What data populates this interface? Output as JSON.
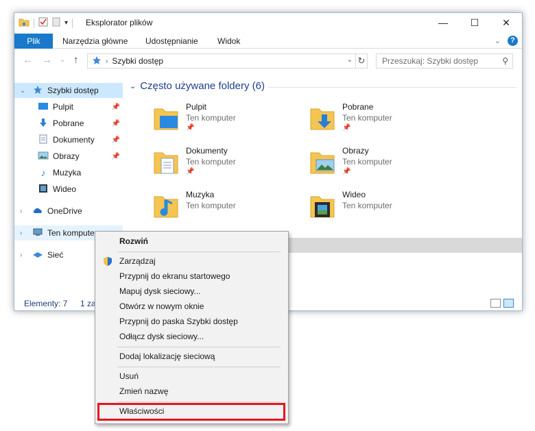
{
  "window": {
    "title": "Eksplorator plików",
    "controls": {
      "minimize": "—",
      "maximize": "☐",
      "close": "✕"
    }
  },
  "ribbon": {
    "tabs": [
      "Plik",
      "Narzędzia główne",
      "Udostępnianie",
      "Widok"
    ],
    "help": "?"
  },
  "address": {
    "breadcrumb": "Szybki dostęp",
    "search_placeholder": "Przeszukaj: Szybki dostęp"
  },
  "sidebar": {
    "items": [
      {
        "label": "Szybki dostęp",
        "icon": "star-icon"
      },
      {
        "label": "Pulpit",
        "icon": "desktop-icon",
        "pinned": true
      },
      {
        "label": "Pobrane",
        "icon": "download-icon",
        "pinned": true
      },
      {
        "label": "Dokumenty",
        "icon": "document-icon",
        "pinned": true
      },
      {
        "label": "Obrazy",
        "icon": "pictures-icon",
        "pinned": true
      },
      {
        "label": "Muzyka",
        "icon": "music-icon"
      },
      {
        "label": "Wideo",
        "icon": "video-icon"
      },
      {
        "label": "OneDrive",
        "icon": "cloud-icon"
      },
      {
        "label": "Ten komputer",
        "icon": "computer-icon"
      },
      {
        "label": "Sieć",
        "icon": "network-icon"
      }
    ]
  },
  "content": {
    "group_title": "Często używane foldery (6)",
    "folders": [
      {
        "name": "Pulpit",
        "location": "Ten komputer",
        "icon": "desktop-folder-icon"
      },
      {
        "name": "Pobrane",
        "location": "Ten komputer",
        "icon": "downloads-folder-icon"
      },
      {
        "name": "Dokumenty",
        "location": "Ten komputer",
        "icon": "documents-folder-icon"
      },
      {
        "name": "Obrazy",
        "location": "Ten komputer",
        "icon": "pictures-folder-icon"
      },
      {
        "name": "Muzyka",
        "location": "Ten komputer",
        "icon": "music-folder-icon"
      },
      {
        "name": "Wideo",
        "location": "Ten komputer",
        "icon": "video-folder-icon"
      }
    ]
  },
  "status": {
    "items": "Elementy: 7",
    "selected": "1 za"
  },
  "context_menu": {
    "items": [
      {
        "label": "Rozwiń",
        "bold": true
      },
      {
        "label": "Zarządzaj",
        "icon": "shield-icon"
      },
      {
        "label": "Przypnij do ekranu startowego"
      },
      {
        "label": "Mapuj dysk sieciowy..."
      },
      {
        "label": "Otwórz w nowym oknie"
      },
      {
        "label": "Przypnij do paska Szybki dostęp"
      },
      {
        "label": "Odłącz dysk sieciowy..."
      },
      {
        "label": "Dodaj lokalizację sieciową"
      },
      {
        "label": "Usuń"
      },
      {
        "label": "Zmień nazwę"
      },
      {
        "label": "Właściwości",
        "highlighted": true
      }
    ]
  },
  "colors": {
    "accent": "#1979ca",
    "selection": "#cce8ff",
    "group_header": "#1e3f8a",
    "highlight_border": "#e8141c",
    "folder_yellow": "#f5c451"
  }
}
